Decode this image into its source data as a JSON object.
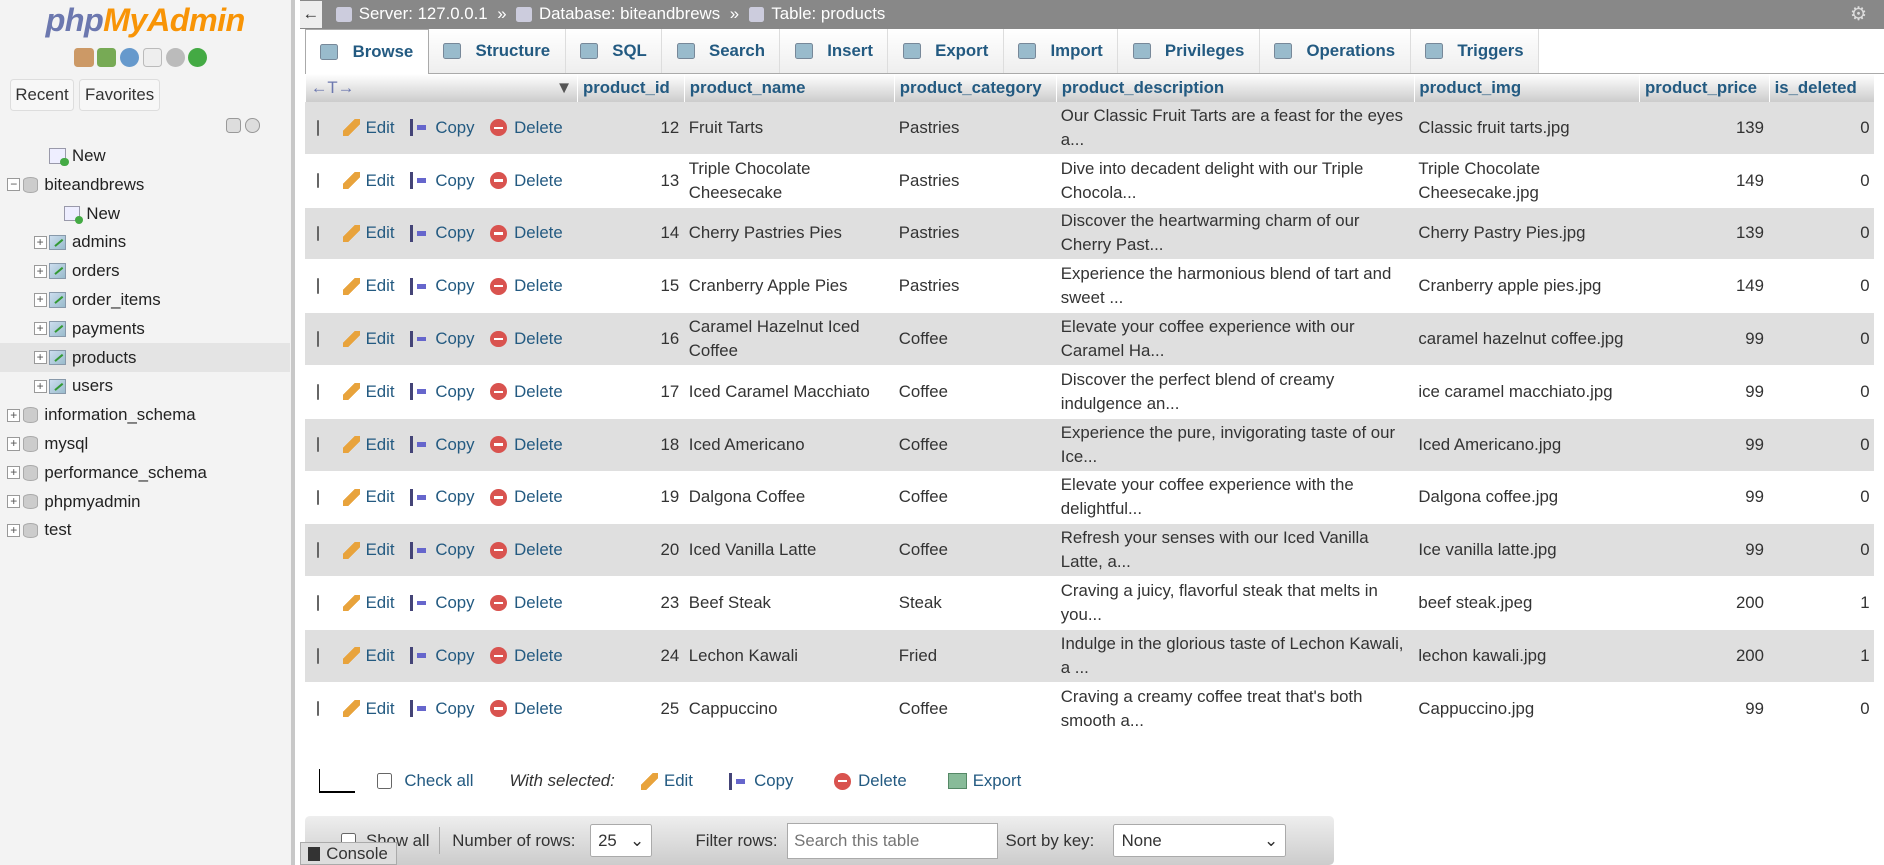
{
  "sidebar": {
    "logo_php": "php",
    "logo_myadmin": "MyAdmin",
    "recent": "Recent",
    "favorites": "Favorites",
    "tree": [
      {
        "label": "New",
        "level": 1,
        "type": "new"
      },
      {
        "label": "biteandbrews",
        "level": 0,
        "type": "db",
        "expanded": true
      },
      {
        "label": "New",
        "level": 2,
        "type": "new"
      },
      {
        "label": "admins",
        "level": 1,
        "type": "table"
      },
      {
        "label": "orders",
        "level": 1,
        "type": "table"
      },
      {
        "label": "order_items",
        "level": 1,
        "type": "table"
      },
      {
        "label": "payments",
        "level": 1,
        "type": "table"
      },
      {
        "label": "products",
        "level": 1,
        "type": "table",
        "selected": true
      },
      {
        "label": "users",
        "level": 1,
        "type": "table"
      },
      {
        "label": "information_schema",
        "level": 0,
        "type": "db"
      },
      {
        "label": "mysql",
        "level": 0,
        "type": "db"
      },
      {
        "label": "performance_schema",
        "level": 0,
        "type": "db"
      },
      {
        "label": "phpmyadmin",
        "level": 0,
        "type": "db"
      },
      {
        "label": "test",
        "level": 0,
        "type": "db"
      }
    ]
  },
  "breadcrumb": {
    "server": "Server: 127.0.0.1",
    "database": "Database: biteandbrews",
    "table": "Table: products",
    "sep": "»"
  },
  "tabs": [
    "Browse",
    "Structure",
    "SQL",
    "Search",
    "Insert",
    "Export",
    "Import",
    "Privileges",
    "Operations",
    "Triggers"
  ],
  "columns": [
    "product_id",
    "product_name",
    "product_category",
    "product_description",
    "product_img",
    "product_price",
    "is_deleted"
  ],
  "actions": {
    "edit": "Edit",
    "copy": "Copy",
    "delete": "Delete"
  },
  "rows": [
    [
      "12",
      "Fruit Tarts",
      "Pastries",
      "Our Classic Fruit Tarts are a feast for the eyes a...",
      "Classic fruit tarts.jpg",
      "139",
      "0"
    ],
    [
      "13",
      "Triple Chocolate Cheesecake",
      "Pastries",
      "Dive into decadent delight with our Triple Chocola...",
      "Triple Chocolate Cheesecake.jpg",
      "149",
      "0"
    ],
    [
      "14",
      "Cherry Pastries Pies",
      "Pastries",
      "Discover the heartwarming charm of our Cherry Past...",
      "Cherry Pastry Pies.jpg",
      "139",
      "0"
    ],
    [
      "15",
      "Cranberry Apple Pies",
      "Pastries",
      "Experience the harmonious blend of tart and sweet ...",
      "Cranberry apple pies.jpg",
      "149",
      "0"
    ],
    [
      "16",
      "Caramel Hazelnut Iced Coffee",
      "Coffee",
      "Elevate your coffee experience with our Caramel Ha...",
      "caramel hazelnut coffee.jpg",
      "99",
      "0"
    ],
    [
      "17",
      "Iced Caramel Macchiato",
      "Coffee",
      "Discover the perfect blend of creamy indulgence an...",
      "ice caramel macchiato.jpg",
      "99",
      "0"
    ],
    [
      "18",
      "Iced Americano",
      "Coffee",
      "Experience the pure, invigorating taste of our Ice...",
      "Iced Americano.jpg",
      "99",
      "0"
    ],
    [
      "19",
      "Dalgona Coffee",
      "Coffee",
      "Elevate your coffee experience with the delightful...",
      "Dalgona coffee.jpg",
      "99",
      "0"
    ],
    [
      "20",
      "Iced Vanilla Latte",
      "Coffee",
      "Refresh your senses with our Iced Vanilla Latte, a...",
      "Ice vanilla latte.jpg",
      "99",
      "0"
    ],
    [
      "23",
      "Beef Steak",
      "Steak",
      "Craving a juicy, flavorful steak that melts in you...",
      "beef steak.jpeg",
      "200",
      "1"
    ],
    [
      "24",
      "Lechon Kawali",
      "Fried",
      "Indulge in the glorious taste of Lechon Kawali, a ...",
      "lechon kawali.jpg",
      "200",
      "1"
    ],
    [
      "25",
      "Cappuccino",
      "Coffee",
      "Craving a creamy coffee treat that's both smooth a...",
      "Cappuccino.jpg",
      "99",
      "0"
    ]
  ],
  "footer": {
    "check_all": "Check all",
    "with_selected": "With selected:",
    "edit": "Edit",
    "copy": "Copy",
    "delete": "Delete",
    "export": "Export"
  },
  "bar": {
    "show_all": "Show all",
    "num_rows_label": "Number of rows:",
    "num_rows": "25",
    "filter_label": "Filter rows:",
    "filter_placeholder": "Search this table",
    "sort_label": "Sort by key:",
    "sort_value": "None"
  },
  "console": "Console"
}
